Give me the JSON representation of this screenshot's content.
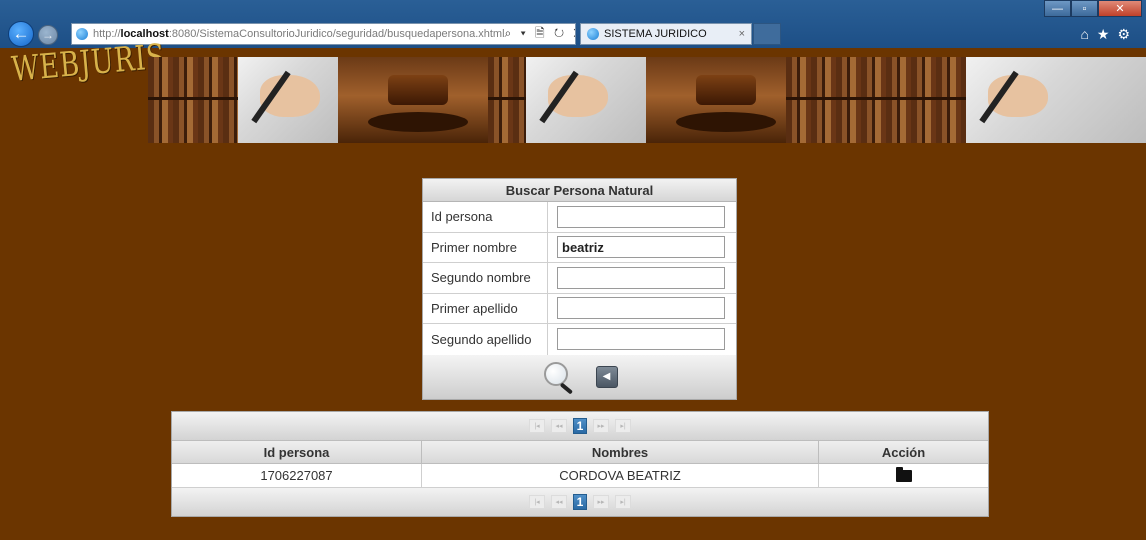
{
  "browser": {
    "url_prefix": "http://",
    "url_host": "localhost",
    "url_rest": ":8080/SistemaConsultorioJuridico/seguridad/busquedapersona.xhtml",
    "url_tools": "⌕ ▾ 🗎 ↻ ✕",
    "tab_title": "SISTEMA JURIDICO",
    "tab_close": "×",
    "back": "←",
    "forward": "→",
    "win_min": "—",
    "win_max": "▫",
    "win_close": "✕",
    "right_tools": "⌂★⚙",
    "icons": [
      "back-arrow-icon",
      "forward-arrow-icon",
      "ie-icon",
      "search-icon",
      "refresh-icon",
      "close-icon",
      "home-icon",
      "star-icon",
      "gear-icon"
    ]
  },
  "banner": {
    "logo": "WEBJURIS",
    "panels": [
      "books",
      "hand",
      "gavel",
      "books",
      "hand",
      "gavel",
      "books",
      "hand"
    ]
  },
  "search_form": {
    "title": "Buscar Persona Natural",
    "fields": [
      {
        "label": "Id persona",
        "value": ""
      },
      {
        "label": "Primer nombre",
        "value": "beatriz"
      },
      {
        "label": "Segundo nombre",
        "value": ""
      },
      {
        "label": "Primer apellido",
        "value": ""
      },
      {
        "label": "Segundo apellido",
        "value": ""
      }
    ],
    "back_symbol": "◀",
    "icons": [
      "magnifier-icon",
      "back-icon"
    ]
  },
  "results": {
    "pager": {
      "first": "|◂",
      "prev": "◂◂",
      "current": "1",
      "next": "▸▸",
      "last": "▸|"
    },
    "columns": [
      "Id persona",
      "Nombres",
      "Acción"
    ],
    "rows": [
      {
        "id": "1706227087",
        "nombres": "CORDOVA BEATRIZ",
        "accion_icon": "folder-icon"
      }
    ]
  }
}
